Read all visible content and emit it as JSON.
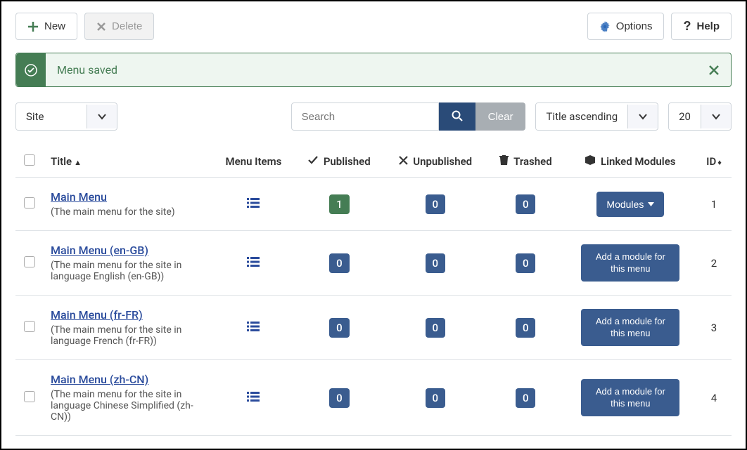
{
  "toolbar": {
    "new_label": "New",
    "delete_label": "Delete",
    "options_label": "Options",
    "help_label": "Help"
  },
  "alert": {
    "message": "Menu saved"
  },
  "filters": {
    "site_label": "Site",
    "search_placeholder": "Search",
    "clear_label": "Clear",
    "sort_label": "Title ascending",
    "limit_label": "20"
  },
  "columns": {
    "title": "Title",
    "menu_items": "Menu Items",
    "published": "Published",
    "unpublished": "Unpublished",
    "trashed": "Trashed",
    "linked_modules": "Linked Modules",
    "id": "ID"
  },
  "modules_dropdown_label": "Modules",
  "add_module_label": "Add a module for this menu",
  "rows": [
    {
      "title": "Main Menu",
      "desc": "(The main menu for the site)",
      "published": "1",
      "published_green": true,
      "unpublished": "0",
      "trashed": "0",
      "has_modules": true,
      "id": "1"
    },
    {
      "title": "Main Menu (en-GB)",
      "desc": "(The main menu for the site in language English (en-GB))",
      "published": "0",
      "published_green": false,
      "unpublished": "0",
      "trashed": "0",
      "has_modules": false,
      "id": "2"
    },
    {
      "title": "Main Menu (fr-FR)",
      "desc": "(The main menu for the site in language French (fr-FR))",
      "published": "0",
      "published_green": false,
      "unpublished": "0",
      "trashed": "0",
      "has_modules": false,
      "id": "3"
    },
    {
      "title": "Main Menu (zh-CN)",
      "desc": "(The main menu for the site in language Chinese Simplified (zh-CN))",
      "published": "0",
      "published_green": false,
      "unpublished": "0",
      "trashed": "0",
      "has_modules": false,
      "id": "4"
    }
  ]
}
